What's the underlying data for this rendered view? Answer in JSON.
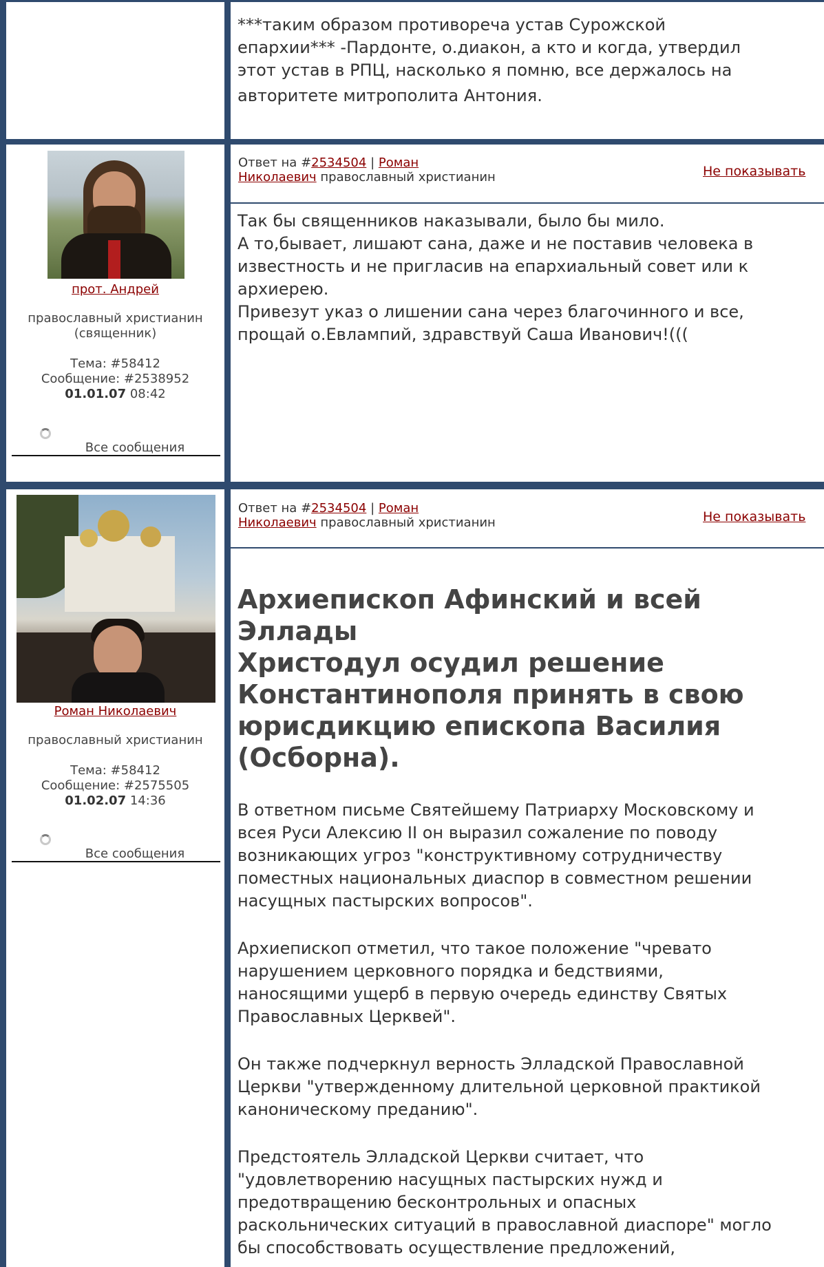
{
  "post0": {
    "body_lines": [
      "***таким образом противореча устав Сурожской",
      "епархии*** -Пардонте, о.диакон, а кто и когда, утвердил",
      "этот устав в РПЦ, насколько я помню, все держалось на",
      "авторитете митрополита Антония."
    ]
  },
  "post1": {
    "reply_prefix": "Ответ на #",
    "reply_num": "2534504",
    "sep": "|",
    "author_link_1": "Роман",
    "author_link_2": "Николаевич",
    "author_role": "православный христианин",
    "hide": "Не показывать",
    "user_name": "прот. Андрей",
    "user_role": "православный христианин",
    "user_role2": "(священник)",
    "topic": "Тема: #58412",
    "message": "Сообщение: #2538952",
    "date_bold": "01.01.07",
    "time": "08:42",
    "all_messages": "Все сообщения",
    "avatar_icon": "avatar-photo",
    "body_lines": [
      "Так бы священников наказывали, было бы мило.",
      "А то,бывает, лишают сана, даже и не поставив человека в",
      "известность и не пригласив на епархиальный совет или к",
      "архиерею.",
      "Привезут указ о лишении сана через благочинного и все,",
      "прощай о.Евлампий, здравствуй Саша Иванович!((("
    ]
  },
  "post2": {
    "reply_prefix": "Ответ на #",
    "reply_num": "2534504",
    "sep": "|",
    "author_link_1": "Роман",
    "author_link_2": "Николаевич",
    "author_role": "православный христианин",
    "hide": "Не показывать",
    "user_name": "Роман Николаевич",
    "user_role": "православный христианин",
    "topic": "Тема: #58412",
    "message": "Сообщение: #2575505",
    "date_bold": "01.02.07",
    "time": "14:36",
    "all_messages": "Все сообщения",
    "headline_lines": [
      "Архиепископ Афинский и всей Эллады",
      "Христодул осудил решение",
      "Константинополя принять в свою",
      "юрисдикцию епископа Василия",
      "(Осборна)."
    ],
    "paragraphs": [
      [
        "В ответном письме Святейшему Патриарху Московскому и",
        "всея Руси Алексию II он выразил сожаление по поводу",
        "возникающих угроз \"конструктивному сотрудничеству",
        "поместных национальных диаспор в совместном решении",
        "насущных пастырских вопросов\"."
      ],
      [
        "Архиепископ отметил, что такое положение \"чревато",
        "нарушением церковного порядка и бедствиями,",
        "наносящими ущерб в первую очередь единству Святых",
        "Православных Церквей\"."
      ],
      [
        "Он также подчеркнул верность Элладской Православной",
        "Церкви \"утвержденному длительной церковной практикой",
        "каноническому преданию\"."
      ],
      [
        "Предстоятель Элладской Церкви считает, что",
        "\"удовлетворению насущных пастырских нужд и",
        "предотвращению бесконтрольных и опасных",
        "раскольнических ситуаций в православной диаспоре\" могло",
        "бы способствовать осуществление предложений,"
      ]
    ]
  }
}
